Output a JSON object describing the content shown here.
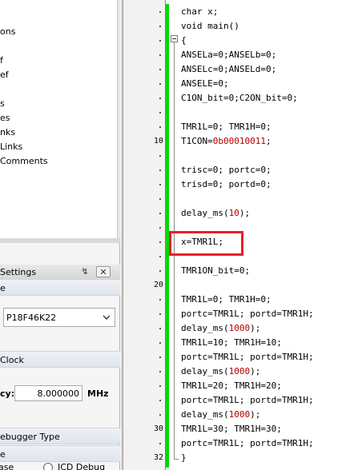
{
  "tree": {
    "items": [
      "ons",
      "",
      "f",
      "ef",
      "",
      "s",
      "es",
      "nks",
      "Links",
      "Comments"
    ]
  },
  "settings": {
    "title": "Settings",
    "pin_icon": "pin-icon",
    "close_icon": "close-icon",
    "section_device": "e",
    "device_value": "P18F46K22",
    "section_clock": "Clock",
    "freq_label": "cy:",
    "freq_value": "8.000000",
    "freq_unit": "MHz",
    "section_debugger": "ebugger Type",
    "section_e": "e",
    "radio_left": "ase",
    "radio_label": "ICD Debug"
  },
  "editor": {
    "line_numbers": {
      "l10": "10",
      "l20": "20",
      "l30": "30",
      "l32": "32"
    },
    "change_bar_color": "#00d800",
    "highlight_color": "#e8202a",
    "lines": [
      {
        "t": "char x;"
      },
      {
        "t": "void main()"
      },
      {
        "t": "{"
      },
      {
        "t": "ANSELa=0;ANSELb=0;"
      },
      {
        "t": "ANSELc=0;ANSELd=0;"
      },
      {
        "t": "ANSELE=0;"
      },
      {
        "t": "C1ON_bit=0;C2ON_bit=0;"
      },
      {
        "t": ""
      },
      {
        "t": "TMR1L=0; TMR1H=0;"
      },
      {
        "pre": "T1CON=",
        "num": "0b00010011",
        "post": ";"
      },
      {
        "t": ""
      },
      {
        "t": "trisc=0; portc=0;"
      },
      {
        "t": "trisd=0; portd=0;"
      },
      {
        "t": ""
      },
      {
        "pre": "delay_ms(",
        "num": "10",
        "post": ");"
      },
      {
        "t": ""
      },
      {
        "t": "x=TMR1L;"
      },
      {
        "t": ""
      },
      {
        "t": "TMR1ON_bit=0;"
      },
      {
        "t": ""
      },
      {
        "t": "TMR1L=0; TMR1H=0;"
      },
      {
        "t": "portc=TMR1L; portd=TMR1H;"
      },
      {
        "pre": "delay_ms(",
        "num": "1000",
        "post": ");"
      },
      {
        "t": "TMR1L=10; TMR1H=10;"
      },
      {
        "t": "portc=TMR1L; portd=TMR1H;"
      },
      {
        "pre": "delay_ms(",
        "num": "1000",
        "post": ");"
      },
      {
        "t": "TMR1L=20; TMR1H=20;"
      },
      {
        "t": "portc=TMR1L; portd=TMR1H;"
      },
      {
        "pre": "delay_ms(",
        "num": "1000",
        "post": ");"
      },
      {
        "t": "TMR1L=30; TMR1H=30;"
      },
      {
        "t": "portc=TMR1L; portd=TMR1H;"
      },
      {
        "t": "}"
      }
    ]
  }
}
